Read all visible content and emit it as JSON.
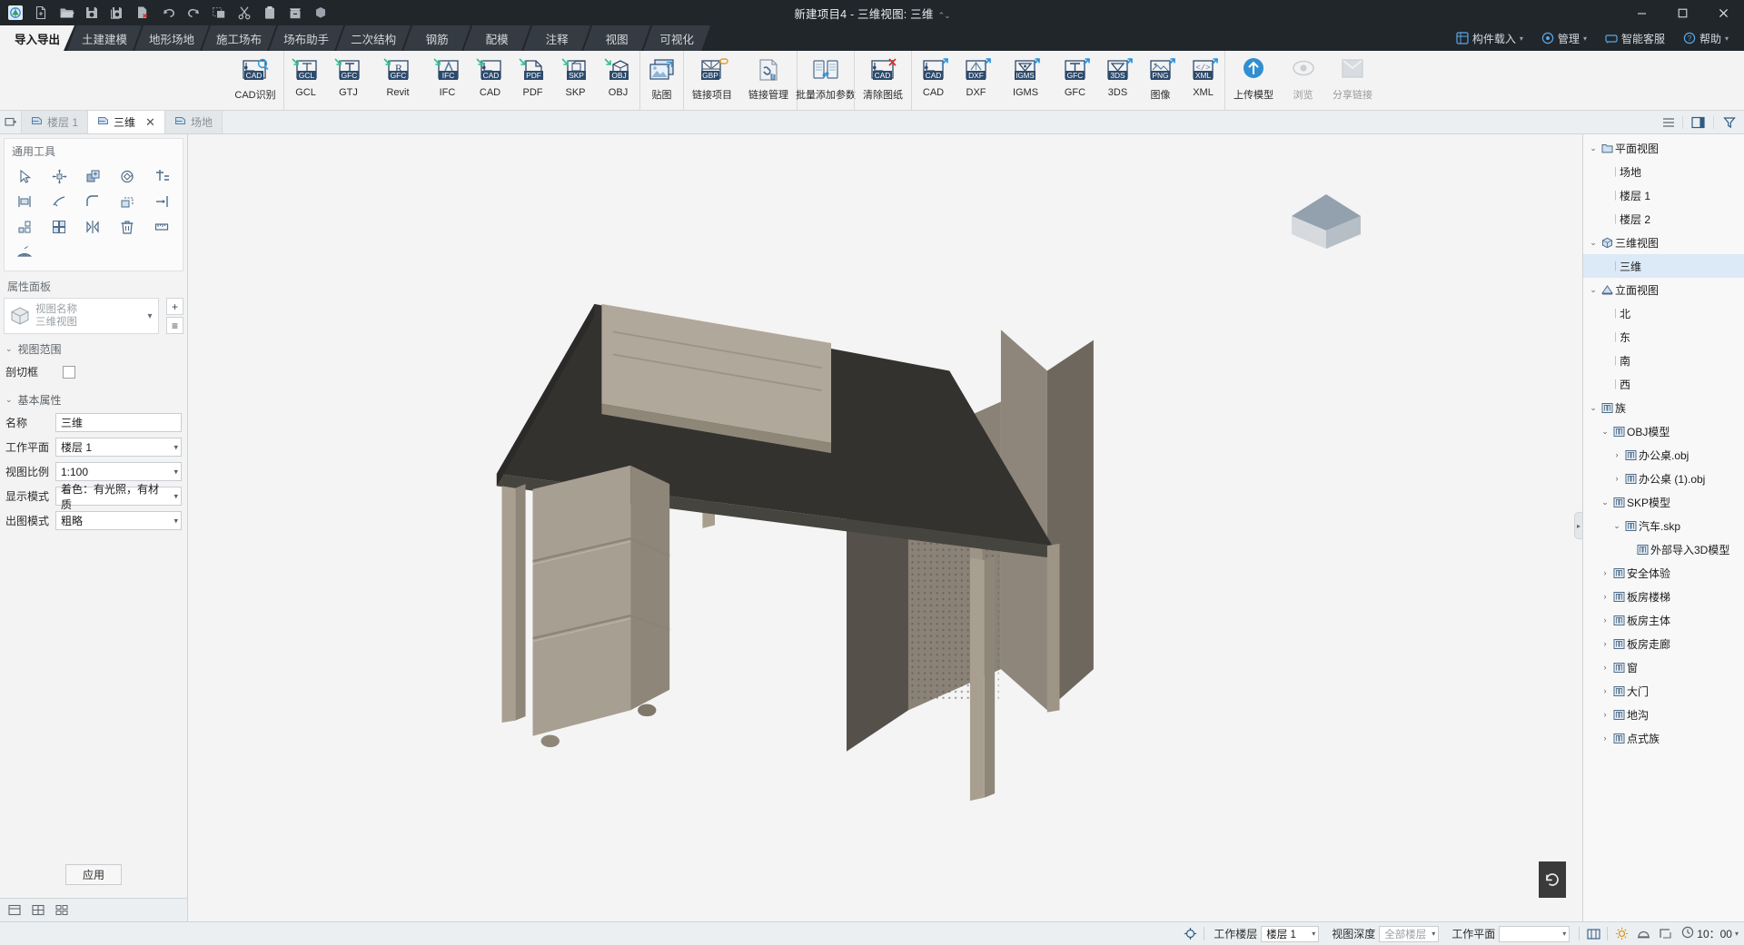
{
  "titlebar": {
    "title": "新建项目4 - 三维视图: 三维",
    "quick_access": [
      {
        "name": "app-logo-icon",
        "label": "应用程序"
      },
      {
        "name": "new-file-icon",
        "label": "新建"
      },
      {
        "name": "open-folder-icon",
        "label": "打开"
      },
      {
        "name": "save-icon",
        "label": "保存"
      },
      {
        "name": "save-as-icon",
        "label": "另存为"
      },
      {
        "name": "close-file-icon",
        "label": "关闭"
      },
      {
        "name": "undo-icon",
        "label": "撤销"
      },
      {
        "name": "redo-icon",
        "label": "恢复"
      },
      {
        "name": "copy-icon",
        "label": "复制"
      },
      {
        "name": "cut-icon",
        "label": "剪切"
      },
      {
        "name": "paste-icon",
        "label": "粘贴"
      },
      {
        "name": "archive-icon",
        "label": "归档"
      },
      {
        "name": "block-icon",
        "label": "构件"
      }
    ],
    "window_controls": [
      "minimize",
      "maximize",
      "close"
    ]
  },
  "tabs": [
    {
      "label": "导入导出",
      "active": true
    },
    {
      "label": "土建建模",
      "active": false
    },
    {
      "label": "地形场地",
      "active": false
    },
    {
      "label": "施工场布",
      "active": false
    },
    {
      "label": "场布助手",
      "active": false
    },
    {
      "label": "二次结构",
      "active": false
    },
    {
      "label": "钢筋",
      "active": false
    },
    {
      "label": "配模",
      "active": false
    },
    {
      "label": "注释",
      "active": false
    },
    {
      "label": "视图",
      "active": false
    },
    {
      "label": "可视化",
      "active": false
    }
  ],
  "right_menus": [
    {
      "label": "构件载入",
      "icon": "grid-load-icon",
      "caret": true
    },
    {
      "label": "管理",
      "icon": "manage-icon",
      "caret": true
    },
    {
      "label": "智能客服",
      "icon": "service-icon",
      "caret": false
    },
    {
      "label": "帮助",
      "icon": "help-icon",
      "caret": true
    }
  ],
  "ribbon": {
    "groups": [
      {
        "name": "cad-recognize",
        "items": [
          {
            "label": "CAD识别",
            "icon": "cad-search-icon",
            "badge": "CAD"
          }
        ]
      },
      {
        "name": "import",
        "items": [
          {
            "label": "GCL",
            "icon": "import-gcl-icon",
            "badge": "GCL"
          },
          {
            "label": "GTJ",
            "icon": "import-gfc-icon",
            "badge": "GFC"
          },
          {
            "label": "Revit",
            "icon": "import-revit-icon",
            "badge": "GFC"
          },
          {
            "label": "IFC",
            "icon": "import-ifc-icon",
            "badge": "IFC"
          },
          {
            "label": "CAD",
            "icon": "import-cad-icon",
            "badge": "CAD"
          },
          {
            "label": "PDF",
            "icon": "import-pdf-icon",
            "badge": "PDF"
          },
          {
            "label": "SKP",
            "icon": "import-skp-icon",
            "badge": "SKP"
          },
          {
            "label": "OBJ",
            "icon": "import-obj-icon",
            "badge": "OBJ"
          }
        ]
      },
      {
        "name": "texture",
        "items": [
          {
            "label": "贴图",
            "icon": "texture-image-icon",
            "badge": ""
          }
        ]
      },
      {
        "name": "link",
        "items": [
          {
            "label": "链接项目",
            "icon": "link-project-icon",
            "badge": "GBP"
          },
          {
            "label": "链接管理",
            "icon": "link-manage-icon",
            "badge": ""
          }
        ]
      },
      {
        "name": "params",
        "items": [
          {
            "label": "批量添加参数",
            "icon": "batch-params-icon",
            "badge": ""
          }
        ]
      },
      {
        "name": "clear",
        "items": [
          {
            "label": "清除图纸",
            "icon": "clear-drawing-icon",
            "badge": "CAD"
          }
        ]
      },
      {
        "name": "export",
        "items": [
          {
            "label": "CAD",
            "icon": "export-cad-icon",
            "badge": "CAD"
          },
          {
            "label": "DXF",
            "icon": "export-dxf-icon",
            "badge": "DXF"
          },
          {
            "label": "IGMS",
            "icon": "export-igms-icon",
            "badge": "IGMS"
          },
          {
            "label": "GFC",
            "icon": "export-gfc-icon",
            "badge": "GFC"
          },
          {
            "label": "3DS",
            "icon": "export-3ds-icon",
            "badge": "3DS"
          },
          {
            "label": "图像",
            "icon": "export-png-icon",
            "badge": "PNG"
          },
          {
            "label": "XML",
            "icon": "export-xml-icon",
            "badge": "XML"
          }
        ]
      },
      {
        "name": "cloud",
        "items": [
          {
            "label": "上传模型",
            "icon": "upload-model-icon",
            "badge": ""
          },
          {
            "label": "浏览",
            "icon": "browse-icon",
            "badge": "",
            "dim": true
          },
          {
            "label": "分享链接",
            "icon": "share-link-icon",
            "badge": "",
            "dim": true
          }
        ]
      }
    ]
  },
  "view_tabs": {
    "first_button": "restore-window-icon",
    "items": [
      {
        "label": "楼层 1",
        "icon": "view-tab-icon",
        "active": false,
        "closable": false
      },
      {
        "label": "三维",
        "icon": "view-tab-icon",
        "active": true,
        "closable": true
      },
      {
        "label": "场地",
        "icon": "view-tab-icon",
        "active": false,
        "closable": false
      }
    ],
    "hamburger": "menu-icon",
    "panel_toggle": "panel-layout-icon",
    "filter": "filter-icon"
  },
  "left_panel": {
    "tools_title": "通用工具",
    "tools": [
      {
        "name": "select-tool"
      },
      {
        "name": "move-tool"
      },
      {
        "name": "copy-tool"
      },
      {
        "name": "rotate-tool"
      },
      {
        "name": "trim-tool"
      },
      {
        "name": "align-tool"
      },
      {
        "name": "split-tool"
      },
      {
        "name": "fillet-tool"
      },
      {
        "name": "offset-tool"
      },
      {
        "name": "extend-tool"
      },
      {
        "name": "array-tool"
      },
      {
        "name": "group-tool"
      },
      {
        "name": "mirror-tool"
      },
      {
        "name": "delete-tool"
      },
      {
        "name": "measure-tool"
      },
      {
        "name": "angle-tool"
      }
    ],
    "props_title": "属性面板",
    "view_selector": {
      "icon": "cube-icon",
      "line1": "视图名称",
      "line2": "三维视图",
      "chevron": "chevron-down-icon",
      "add_button": "+",
      "menu_button": "≡"
    },
    "sections": [
      {
        "title": "视图范围",
        "expanded": true,
        "rows": [
          {
            "label": "剖切框",
            "type": "checkbox",
            "value": false
          }
        ]
      },
      {
        "title": "基本属性",
        "expanded": true,
        "rows": [
          {
            "label": "名称",
            "type": "text",
            "value": "三维"
          },
          {
            "label": "工作平面",
            "type": "select",
            "value": "楼层 1"
          },
          {
            "label": "视图比例",
            "type": "select",
            "value": "1:100"
          },
          {
            "label": "显示模式",
            "type": "select",
            "value": "着色：有光照，有材质"
          },
          {
            "label": "出图模式",
            "type": "select",
            "value": "粗略"
          }
        ]
      }
    ],
    "apply_button": "应用",
    "bottom_buttons": [
      {
        "name": "layout-view-icon"
      },
      {
        "name": "grid-view-icon"
      },
      {
        "name": "multi-view-icon"
      }
    ]
  },
  "viewport": {
    "navcube": "house-navigation-icon",
    "collapse_handle": "collapse-panel-icon",
    "reset_button": "reset-view-icon"
  },
  "right_panel": {
    "tree": [
      {
        "label": "平面视图",
        "depth": 0,
        "twisty": "down",
        "icon": "folder-view-icon",
        "selected": false
      },
      {
        "label": "场地",
        "depth": 1,
        "twisty": "none",
        "icon": "none",
        "selected": false
      },
      {
        "label": "楼层 1",
        "depth": 1,
        "twisty": "none",
        "icon": "none",
        "selected": false
      },
      {
        "label": "楼层 2",
        "depth": 1,
        "twisty": "none",
        "icon": "none",
        "selected": false
      },
      {
        "label": "三维视图",
        "depth": 0,
        "twisty": "down",
        "icon": "cube-view-icon",
        "selected": false
      },
      {
        "label": "三维",
        "depth": 1,
        "twisty": "none",
        "icon": "none",
        "selected": true
      },
      {
        "label": "立面视图",
        "depth": 0,
        "twisty": "down",
        "icon": "elevation-icon",
        "selected": false
      },
      {
        "label": "北",
        "depth": 1,
        "twisty": "none",
        "icon": "none",
        "selected": false
      },
      {
        "label": "东",
        "depth": 1,
        "twisty": "none",
        "icon": "none",
        "selected": false
      },
      {
        "label": "南",
        "depth": 1,
        "twisty": "none",
        "icon": "none",
        "selected": false
      },
      {
        "label": "西",
        "depth": 1,
        "twisty": "none",
        "icon": "none",
        "selected": false
      },
      {
        "label": "族",
        "depth": 0,
        "twisty": "down",
        "icon": "family-icon",
        "selected": false
      },
      {
        "label": "OBJ模型",
        "depth": 1,
        "twisty": "down",
        "icon": "family-icon",
        "selected": false
      },
      {
        "label": "办公桌.obj",
        "depth": 2,
        "twisty": "right",
        "icon": "family-icon",
        "selected": false
      },
      {
        "label": "办公桌 (1).obj",
        "depth": 2,
        "twisty": "right",
        "icon": "family-icon",
        "selected": false
      },
      {
        "label": "SKP模型",
        "depth": 1,
        "twisty": "down",
        "icon": "family-icon",
        "selected": false
      },
      {
        "label": "汽车.skp",
        "depth": 2,
        "twisty": "down",
        "icon": "family-icon",
        "selected": false
      },
      {
        "label": "外部导入3D模型",
        "depth": 3,
        "twisty": "none",
        "icon": "family-icon",
        "selected": false
      },
      {
        "label": "安全体验",
        "depth": 1,
        "twisty": "right",
        "icon": "family-icon",
        "selected": false
      },
      {
        "label": "板房楼梯",
        "depth": 1,
        "twisty": "right",
        "icon": "family-icon",
        "selected": false
      },
      {
        "label": "板房主体",
        "depth": 1,
        "twisty": "right",
        "icon": "family-icon",
        "selected": false
      },
      {
        "label": "板房走廊",
        "depth": 1,
        "twisty": "right",
        "icon": "family-icon",
        "selected": false
      },
      {
        "label": "窗",
        "depth": 1,
        "twisty": "right",
        "icon": "family-icon",
        "selected": false
      },
      {
        "label": "大门",
        "depth": 1,
        "twisty": "right",
        "icon": "family-icon",
        "selected": false
      },
      {
        "label": "地沟",
        "depth": 1,
        "twisty": "right",
        "icon": "family-icon",
        "selected": false
      },
      {
        "label": "点式族",
        "depth": 1,
        "twisty": "right",
        "icon": "family-icon",
        "selected": false
      }
    ]
  },
  "statusbar": {
    "target_icon": "crosshair-icon",
    "fields": [
      {
        "label": "工作楼层",
        "value": "楼层 1",
        "name": "work-floor-select"
      },
      {
        "label": "视图深度",
        "value": "全部楼层",
        "name": "view-depth-select",
        "placeholder": true
      },
      {
        "label": "工作平面",
        "value": "",
        "name": "work-plane-select"
      }
    ],
    "icons": [
      {
        "name": "snap-icon"
      },
      {
        "name": "brightness-icon"
      },
      {
        "name": "sun-icon"
      },
      {
        "name": "ortho-icon"
      }
    ],
    "clock": {
      "icon": "clock-icon",
      "value": "10：00",
      "caret": "chevron-down-icon"
    }
  },
  "colors": {
    "titlebar_bg": "#21262b",
    "tab_inactive": "#343b42",
    "tab_active": "#f3f3f3",
    "ribbon_bg": "#f3f3f3",
    "panel_bg": "#f8f8f8",
    "viewport_bg": "#f4f4f4",
    "selection": "#dce9f7",
    "accent_blue": "#1f6fc4",
    "icon_navy": "#2d4a6b",
    "icon_green": "#2fbf8f",
    "desk_top": "#333230",
    "desk_leg": "#a49c8e"
  }
}
